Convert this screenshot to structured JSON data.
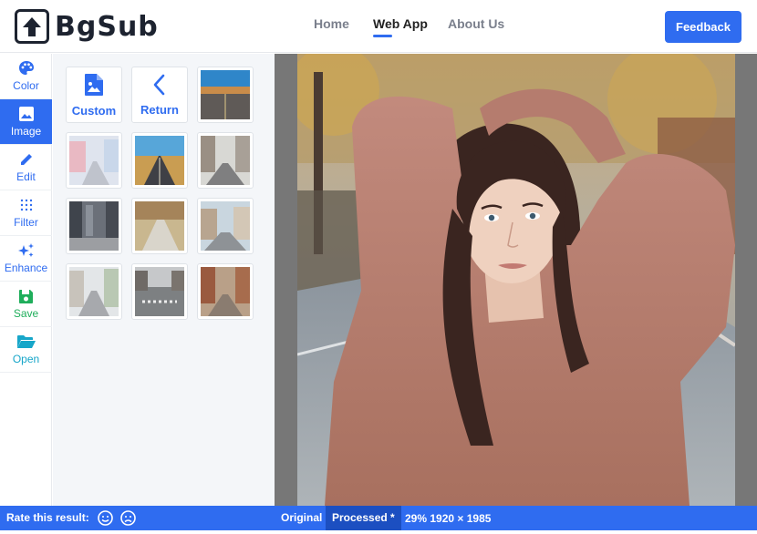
{
  "app": {
    "name": "BgSub"
  },
  "nav": {
    "home": "Home",
    "web_app": "Web App",
    "about": "About Us",
    "feedback": "Feedback"
  },
  "tools": [
    {
      "label": "Color",
      "icon": "palette-icon"
    },
    {
      "label": "Image",
      "icon": "image-icon",
      "active": true
    },
    {
      "label": "Edit",
      "icon": "pencil-icon"
    },
    {
      "label": "Filter",
      "icon": "grid-dots-icon"
    },
    {
      "label": "Enhance",
      "icon": "sparkle-icon"
    },
    {
      "label": "Save",
      "icon": "floppy-disk-icon"
    },
    {
      "label": "Open",
      "icon": "folder-open-icon"
    }
  ],
  "panel": {
    "custom_label": "Custom",
    "return_label": "Return",
    "backgrounds": [
      "road-sky-thumbnail",
      "pastel-street-thumbnail",
      "desert-road-thumbnail",
      "city-street-thumbnail",
      "skyscraper-street-thumbnail",
      "park-path-thumbnail",
      "town-street-thumbnail",
      "alley-street-thumbnail",
      "crosswalk-street-thumbnail",
      "brick-street-thumbnail"
    ]
  },
  "status": {
    "rate_label": "Rate this result:",
    "original": "Original",
    "processed": "Processed *",
    "meta": "29% 1920 × 1985"
  },
  "colors": {
    "accent": "#2f6cf0",
    "canvas_bg": "#777777",
    "panel_bg": "#f4f6f9"
  }
}
